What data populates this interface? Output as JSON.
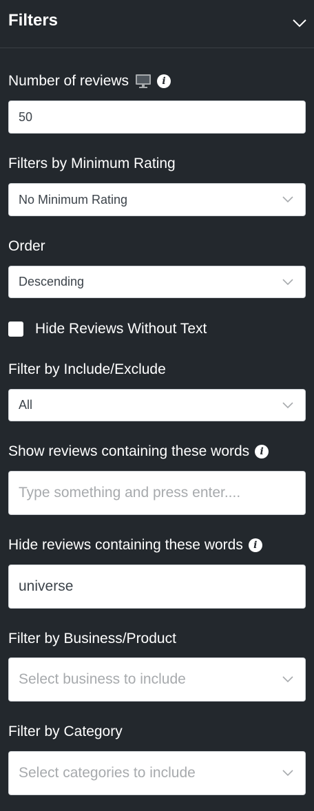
{
  "header": {
    "title": "Filters",
    "toggle_icon": "chevron-down-icon"
  },
  "number_of_reviews": {
    "label": "Number of reviews",
    "value": "50"
  },
  "min_rating": {
    "label": "Filters by Minimum Rating",
    "selected": "No Minimum Rating"
  },
  "order": {
    "label": "Order",
    "selected": "Descending"
  },
  "hide_without_text": {
    "label": "Hide Reviews Without Text",
    "checked": false
  },
  "include_exclude": {
    "label": "Filter by Include/Exclude",
    "selected": "All"
  },
  "show_words": {
    "label": "Show reviews containing these words",
    "placeholder": "Type something and press enter...."
  },
  "hide_words": {
    "label": "Hide reviews containing these words",
    "value": "universe"
  },
  "business": {
    "label": "Filter by Business/Product",
    "placeholder": "Select business to include"
  },
  "category": {
    "label": "Filter by Category",
    "placeholder": "Select categories to include"
  },
  "colors": {
    "background": "#23282d",
    "field_background": "#ffffff",
    "field_text": "#3c434a",
    "placeholder_text": "#a7aaad"
  }
}
